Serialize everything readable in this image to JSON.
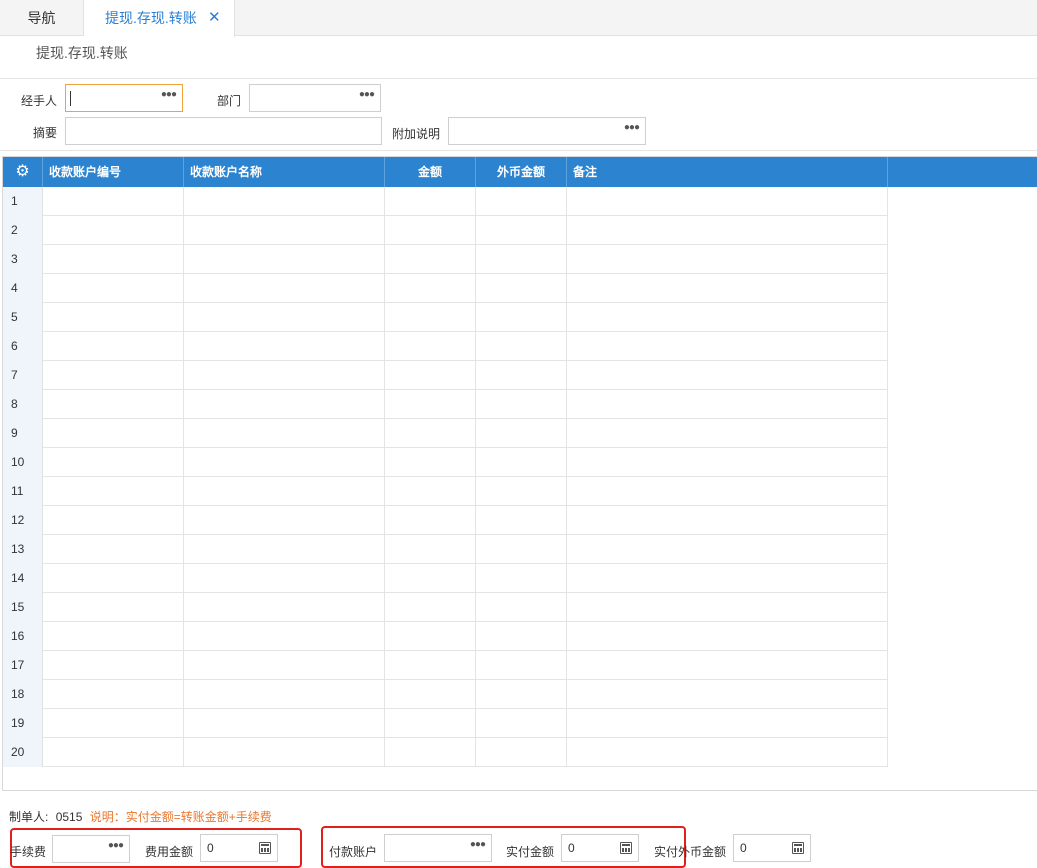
{
  "tabs": {
    "nav": "导航",
    "active": "提现.存现.转账",
    "close": "✕"
  },
  "subtitle": "提现.存现.转账",
  "form": {
    "handler_label": "经手人",
    "dept_label": "部门",
    "summary_label": "摘要",
    "extra_label": "附加说明"
  },
  "grid": {
    "gear_icon": "⚙",
    "columns": [
      "收款账户编号",
      "收款账户名称",
      "金额",
      "外币金额",
      "备注"
    ],
    "rows": [
      "1",
      "2",
      "3",
      "4",
      "5",
      "6",
      "7",
      "8",
      "9",
      "10",
      "11",
      "12",
      "13",
      "14",
      "15",
      "16",
      "17",
      "18",
      "19",
      "20"
    ]
  },
  "footer": {
    "maker_label": "制单人:",
    "maker_value": "0515",
    "hint": "说明：实付金额=转账金额+手续费",
    "fee_label": "手续费",
    "fee_amount_label": "费用金额",
    "fee_amount_value": "0",
    "pay_account_label": "付款账户",
    "paid_amount_label": "实付金额",
    "paid_amount_value": "0",
    "paid_fx_label": "实付外币金额",
    "paid_fx_value": "0"
  },
  "colors": {
    "header_blue": "#2c84d0",
    "active_tab": "#2a7fd4",
    "hint_orange": "#e8772e",
    "highlight_red": "#e0201b"
  }
}
